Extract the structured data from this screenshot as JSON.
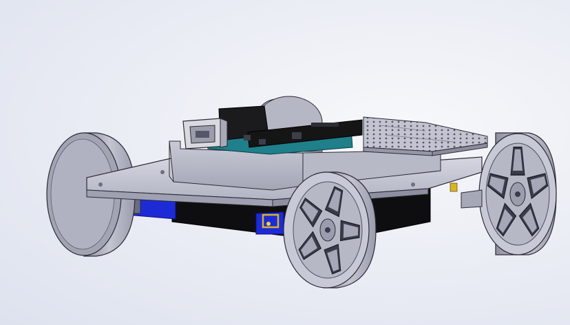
{
  "scene": {
    "subject": "robot-car-chassis-cad-model",
    "colors": {
      "background_light": "#f7f8fb",
      "background_dark": "#dde2ee",
      "chassis": "#c8c9d6",
      "chassis_shadow": "#9fa1b3",
      "wheel": "#b4b6c4",
      "wheel_face": "#cfd0dc",
      "wheel_hub": "#8d8fa0",
      "servo_blue": "#1d2bd6",
      "bracket_yellow": "#d8b32a",
      "battery_black": "#0e0e10",
      "pcb_teal": "#1f7f8a",
      "header_black": "#151515",
      "usb_silver": "#d9d9e0",
      "perfboard": "#b9bac7",
      "outline": "#2a2b33"
    },
    "components": [
      {
        "name": "chassis-plate"
      },
      {
        "name": "left-front-wheel"
      },
      {
        "name": "right-front-wheel"
      },
      {
        "name": "right-rear-wheel"
      },
      {
        "name": "rear-caster-wheel"
      },
      {
        "name": "servo-motor-left"
      },
      {
        "name": "servo-motor-right"
      },
      {
        "name": "battery-pack"
      },
      {
        "name": "microcontroller-board"
      },
      {
        "name": "usb-b-connector"
      },
      {
        "name": "prototype-shield"
      }
    ]
  }
}
